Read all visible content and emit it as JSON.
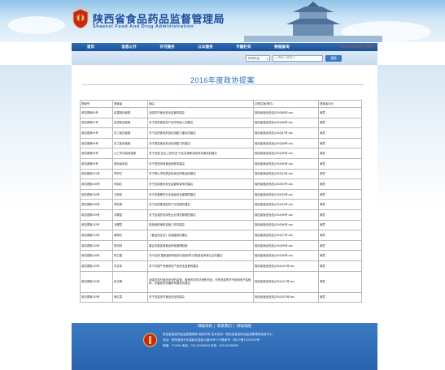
{
  "header": {
    "title": "陕西省食品药品监督管理局",
    "subtitle": "Shaanxi Food And Drug Administration",
    "date": "2017年7月24日 星期一"
  },
  "nav": {
    "items": [
      "首页",
      "信息公开",
      "许可服务",
      "公众服务",
      "专题栏目",
      "数据查询"
    ]
  },
  "search": {
    "select_value": "所有栏目",
    "placeholder": "请输入搜索字",
    "button_label": "搜索"
  },
  "page": {
    "title": "2016年度政协提案"
  },
  "table": {
    "headers": [
      "提案号",
      "提案者",
      "案由",
      "办理文案(附件)",
      "提案者评价"
    ],
    "rows": [
      [
        "政协提案90号",
        "民建陕西省委",
        "加强农村食品安全监管的建议",
        "陕西省食品药品(2016)85号.doc",
        "满意"
      ],
      [
        "政协提案91号",
        "民进陕西省委",
        "关于规范食用农产品市场准入的建议",
        "陕西省食品药品(2016)86号.doc",
        "满意"
      ],
      [
        "政协提案94号",
        "农工陕西省委",
        "关于加快食品药品检测能力建设的建议",
        "陕西省食品药品(2016)87号.doc",
        "满意"
      ],
      [
        "政协提案96号",
        "农工陕西省委",
        "关于提高食品安全检测能力的建议",
        "陕西省食品药品(2016)88号.doc",
        "满意"
      ],
      [
        "政协提案98号",
        "九三学社陕西省委",
        "关于加强\"舌尖上的安全\"行业自律和诚信体系建设的建议",
        "陕西省食品药品(2016)89号.doc",
        "满意"
      ],
      [
        "政协提案99号",
        "陕西省政协",
        "关于规范网络食品销售的建议",
        "陕西省食品药品(2016)90号.doc",
        "满意"
      ],
      [
        "政协提案101号",
        "李岁红",
        "关于禁止学校周边售卖劣质食品的建议",
        "陕西省食品药品(2016)91号.doc",
        "满意"
      ],
      [
        "政协提案105号",
        "何晓红",
        "关于加强食品安全监管和宣传的建议",
        "陕西省食品药品(2016)92号.doc",
        "满意"
      ],
      [
        "政协提案106号",
        "王新宏",
        "关于完善餐饮行业食品安全管理的建议",
        "陕西省食品药品(2016)93号.doc",
        "满意"
      ],
      [
        "政协提案108号",
        "李彩艳",
        "关于加快推进医药产业发展的建议",
        "陕西省食品药品(2016)94号.doc",
        "满意"
      ],
      [
        "政协提案109号",
        "冯耀斌",
        "关于加强药品零售企业规范管理的建议",
        "陕西省食品药品(2016)95号.doc",
        "满意"
      ],
      [
        "政协提案112号",
        "冯耀斌",
        "药品网络销售监管工作的建议",
        "陕西省食品药品(2016)96号.doc",
        "满意"
      ],
      [
        "政协提案113号",
        "黄秀玲",
        "《食品安全法》实施细则的建议",
        "陕西省食品药品(2016)97号.doc",
        "满意"
      ],
      [
        "政协提案116号",
        "陈凤林",
        "建议完善保健食品审批管理制度",
        "陕西省食品药品(2016)98号.doc",
        "满意"
      ],
      [
        "政协提案118号",
        "陈卫国",
        "关于加快\"国家级药物临床试验机构\"在陕西省申报认定的建议",
        "陕西省食品药品(2016)99号.doc",
        "满意"
      ],
      [
        "政协提案119号",
        "孙文军",
        "关于实施产地食用农产品安全监管的建议",
        "陕西省食品药品(2016)100号.doc",
        "满意"
      ],
      [
        "政协提案120号",
        "赵玉梅",
        "加强对农村食品安全的监管，取缔农村非法销售药品；在药品零售环节使用电子监管码，完善医药流通体系建设的建议",
        "陕西省食品药品(2016)101号.doc",
        "满意"
      ],
      [
        "政协提案129号",
        "杨红霞",
        "关于加强农村食品安全的建议",
        "陕西省食品药品(2016)102号.doc",
        "满意"
      ]
    ]
  },
  "footer": {
    "links": [
      "邮箱系统",
      "联系我们",
      "网站地图"
    ],
    "line1": "陕西省食品药品监督管理局 版权所有 技术支持：陕西省食品药品监督管理局信息中心",
    "line2": "地址：陕西省西安市高新区高新六路36号 ICP备案号：陕ICP备11002419号",
    "line3": "邮编：710065 电话：029-62288099 传真：029-62288098"
  },
  "colors": {
    "nav_blue": "#2f6db8",
    "title_blue": "#2e6cb7",
    "link_blue": "#2a56b3",
    "date_orange": "#d4572a"
  }
}
